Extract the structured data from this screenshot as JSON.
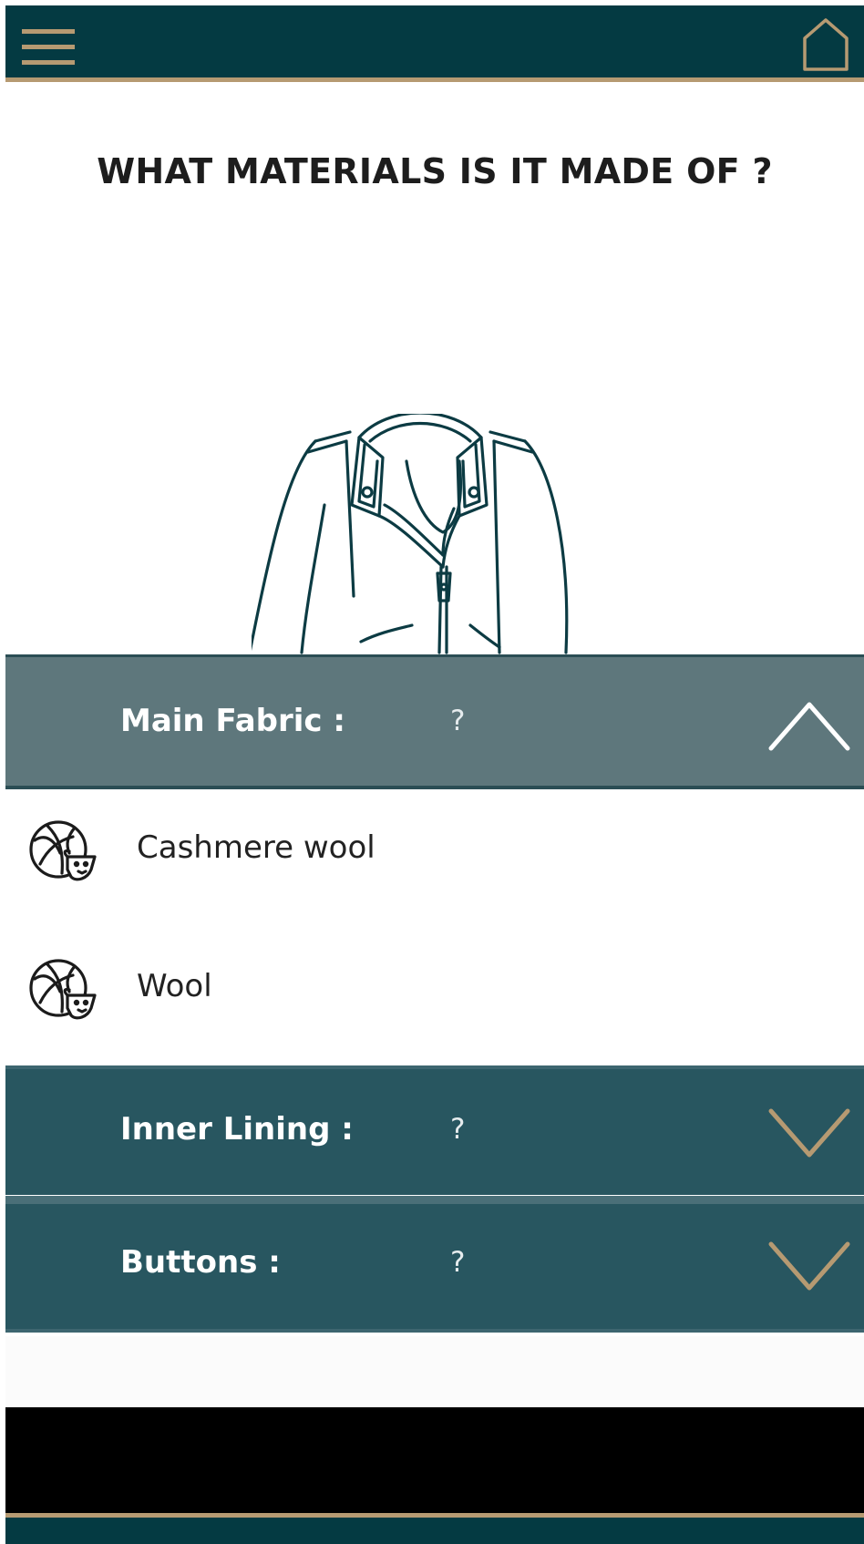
{
  "header": {
    "menu_icon": "hamburger-menu-icon",
    "home_icon": "home-icon",
    "accent_color": "#b69a72",
    "bar_color": "#043a42"
  },
  "page": {
    "title": "WHAT MATERIALS IS IT MADE OF ?",
    "illustration": "leather-jacket-illustration"
  },
  "sections": {
    "main_fabric": {
      "label": "Main Fabric :",
      "value": "?",
      "expanded": true,
      "chevron": "chevron-up-icon",
      "options": [
        {
          "label": "Cashmere wool",
          "icon": "wool-ball-sheep-icon"
        },
        {
          "label": "Wool",
          "icon": "wool-ball-sheep-icon"
        }
      ]
    },
    "inner_lining": {
      "label": "Inner Lining :",
      "value": "?",
      "expanded": false,
      "chevron": "chevron-down-icon"
    },
    "buttons": {
      "label": "Buttons :",
      "value": "?",
      "expanded": false,
      "chevron": "chevron-down-icon"
    }
  }
}
